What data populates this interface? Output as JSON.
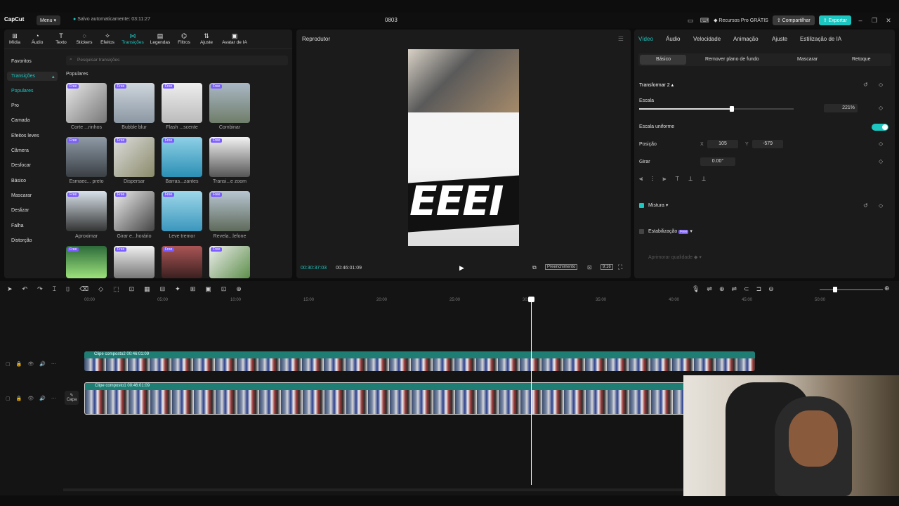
{
  "app": {
    "logo": "CapCut",
    "menu": "Menu",
    "autosave": "Salvo automaticamente: 03:11:27",
    "project": "0803",
    "pro_resources": "Recursos Pro GRÁTIS",
    "share": "Compartilhar",
    "export": "Exportar",
    "accent": "#1cc6c1"
  },
  "tools": [
    {
      "label": "Mídia",
      "icon": "media-icon"
    },
    {
      "label": "Áudio",
      "icon": "audio-icon"
    },
    {
      "label": "Texto",
      "icon": "text-icon"
    },
    {
      "label": "Stickers",
      "icon": "sticker-icon"
    },
    {
      "label": "Efeitos",
      "icon": "effects-icon"
    },
    {
      "label": "Transições",
      "icon": "transitions-icon",
      "active": true
    },
    {
      "label": "Legendas",
      "icon": "captions-icon"
    },
    {
      "label": "Filtros",
      "icon": "filters-icon"
    },
    {
      "label": "Ajuste",
      "icon": "adjust-icon"
    },
    {
      "label": "Avatar de IA",
      "icon": "ai-avatar-icon"
    }
  ],
  "categories": [
    "Favoritos",
    "Transições",
    "Populares",
    "Pro",
    "Camada",
    "Efeitos leves",
    "Câmera",
    "Desfocar",
    "Básico",
    "Mascarar",
    "Deslizar",
    "Falha",
    "Distorção"
  ],
  "search_placeholder": "Pesquisar transições",
  "popular_title": "Populares",
  "free_badge": "Free",
  "transitions": [
    "Corte ...rinhos",
    "Bubble blur",
    "Flash ...scente",
    "Combinar",
    "Esmaec... preto",
    "Dispersar",
    "Barras...zantes",
    "Transi...e zoom",
    "Aproximar",
    "Girar e...horário",
    "Leve tremor",
    "Revela...lefone"
  ],
  "player": {
    "title": "Reprodutor",
    "current": "00:30:37:03",
    "total": "00:46:01:09",
    "fill": "Preenchimento",
    "ratio": "9:16",
    "overlay_text": "EEEI"
  },
  "right": {
    "tabs": [
      "Vídeo",
      "Áudio",
      "Velocidade",
      "Animação",
      "Ajuste",
      "Estilização de IA"
    ],
    "subtabs": [
      "Básico",
      "Remover plano de fundo",
      "Mascarar",
      "Retoque"
    ],
    "transform": "Transformar 2",
    "scale_label": "Escala",
    "scale_value": "221%",
    "scale_fraction": 0.6,
    "uniform": "Escala uniforme",
    "position": "Posição",
    "x_label": "X",
    "x": "105",
    "y_label": "Y",
    "y": "-579",
    "rotate": "Girar",
    "rotate_value": "0.00°",
    "blend": "Mistura",
    "stabilize": "Estabilização",
    "enhance": "Aprimorar qualidade"
  },
  "timeline": {
    "ticks": [
      "00:00",
      "05:00",
      "10:00",
      "15:00",
      "20:00",
      "25:00",
      "30:00",
      "35:00",
      "40:00",
      "45:00",
      "50:00"
    ],
    "clip1": "Clipe composto2  00:46:01:09",
    "clip2": "Clipe composto1  00:46:01:09",
    "cover": "Capa"
  }
}
